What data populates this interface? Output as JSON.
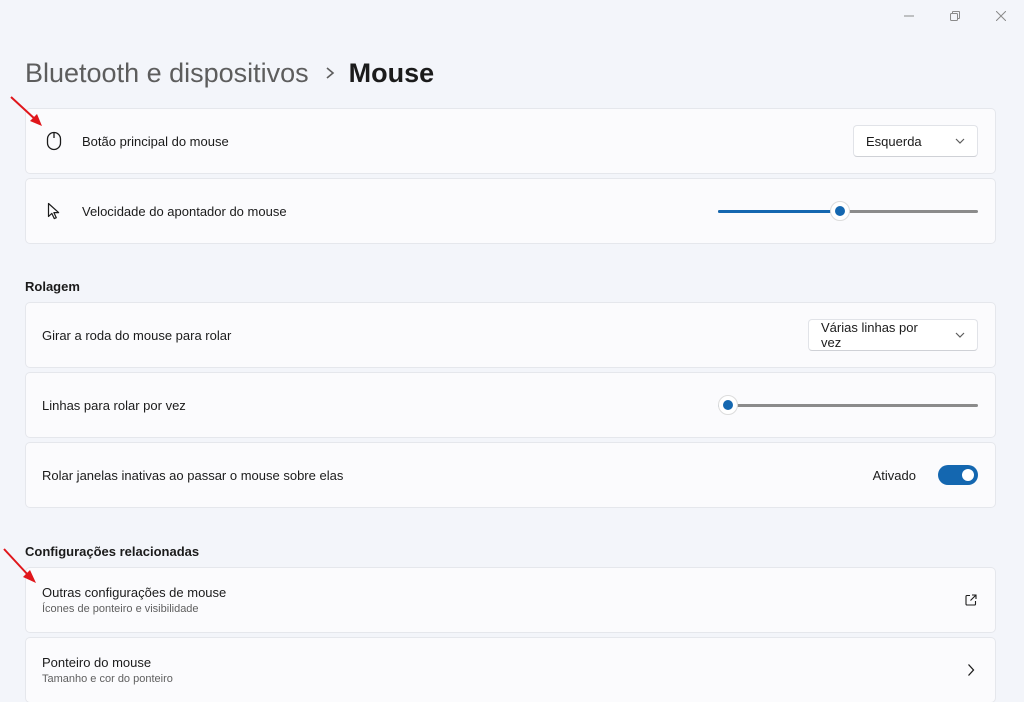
{
  "window": {
    "controls": [
      "minimize-icon",
      "restore-icon",
      "close-icon"
    ]
  },
  "breadcrumb": {
    "parent": "Bluetooth e dispositivos",
    "current": "Mouse"
  },
  "primary_button": {
    "label": "Botão principal do mouse",
    "icon": "mouse-icon",
    "value": "Esquerda"
  },
  "pointer_speed": {
    "label": "Velocidade do apontador do mouse",
    "icon": "pointer-icon",
    "value_fraction": 0.47
  },
  "scroll_section": {
    "title": "Rolagem"
  },
  "wheel_scroll": {
    "label": "Girar a roda do mouse para rolar",
    "value": "Várias linhas por vez"
  },
  "lines_per_scroll": {
    "label": "Linhas para rolar por vez",
    "value_fraction": 0.04
  },
  "inactive_scroll": {
    "label": "Rolar janelas inativas ao passar o mouse sobre elas",
    "state_label": "Ativado",
    "on": true
  },
  "related_section": {
    "title": "Configurações relacionadas"
  },
  "other_settings": {
    "label": "Outras configurações de mouse",
    "sub": "Ícones de ponteiro e visibilidade",
    "icon": "external-link-icon"
  },
  "mouse_pointer": {
    "label": "Ponteiro do mouse",
    "sub": "Tamanho e cor do ponteiro",
    "icon": "chevron-right-icon"
  },
  "colors": {
    "accent": "#1467b0",
    "annotation_arrow": "#e0161b",
    "background": "#f3f5fa",
    "card": "#fbfbfd"
  }
}
